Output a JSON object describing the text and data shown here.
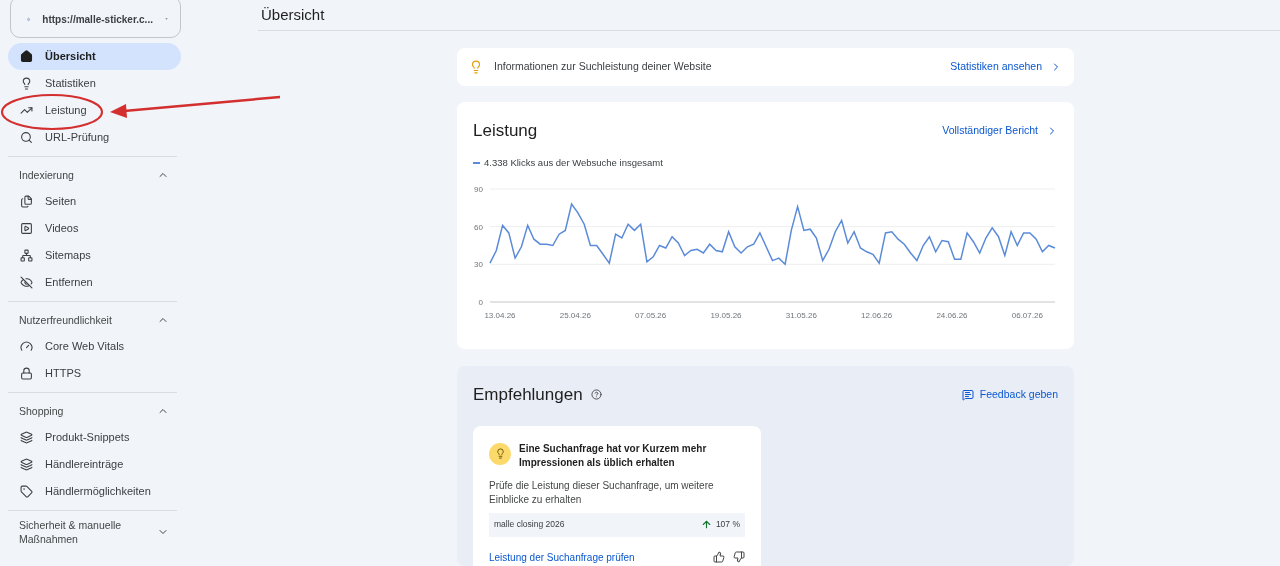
{
  "site_selector": {
    "value": "https://malle-sticker.c..."
  },
  "sidebar": [
    {
      "kind": "group",
      "items": [
        {
          "label": "Übersicht",
          "selected": true
        },
        {
          "label": "Statistiken",
          "selected": false
        },
        {
          "label": "Leistung",
          "selected": false
        },
        {
          "label": "URL-Prüfung",
          "selected": false
        }
      ]
    },
    {
      "kind": "section",
      "title": "Indexierung",
      "expanded": true,
      "items": [
        {
          "label": "Seiten",
          "selected": false
        },
        {
          "label": "Videos",
          "selected": false
        },
        {
          "label": "Sitemaps",
          "selected": false
        },
        {
          "label": "Entfernen",
          "selected": false
        }
      ]
    },
    {
      "kind": "section",
      "title": "Nutzerfreundlichkeit",
      "expanded": true,
      "items": [
        {
          "label": "Core Web Vitals",
          "selected": false
        },
        {
          "label": "HTTPS",
          "selected": false
        }
      ]
    },
    {
      "kind": "section",
      "title": "Shopping",
      "expanded": true,
      "items": [
        {
          "label": "Produkt-Snippets",
          "selected": false
        },
        {
          "label": "Händlereinträge",
          "selected": false
        },
        {
          "label": "Händlermöglichkeiten",
          "selected": false
        }
      ]
    },
    {
      "kind": "section",
      "title": "Sicherheit & manuelle Maßnahmen",
      "expanded": false
    }
  ],
  "page_title": "Übersicht",
  "info_card": {
    "text": "Informationen zur Suchleistung deiner Website",
    "link": "Statistiken ansehen"
  },
  "performance": {
    "title": "Leistung",
    "link": "Vollständiger Bericht",
    "legend": "4.338 Klicks aus der Websuche insgesamt",
    "x_axis_labels": [
      "13.04.26",
      "25.04.26",
      "07.05.26",
      "19.05.26",
      "31.05.26",
      "12.06.26",
      "24.06.26",
      "06.07.26"
    ],
    "chart_data": {
      "type": "line",
      "series": [
        {
          "color": "#5b8bd8",
          "values": [
            31,
            41,
            61,
            55,
            35,
            44,
            61,
            50,
            46,
            46,
            45,
            54,
            57,
            78,
            71,
            62,
            45,
            45,
            38,
            31,
            54,
            51,
            62,
            57,
            62,
            32,
            36,
            45,
            43,
            52,
            47,
            37,
            41,
            42,
            39,
            46,
            41,
            40,
            56,
            44,
            39,
            44,
            46,
            55,
            44,
            33,
            35,
            30,
            57,
            76,
            57,
            58,
            51,
            33,
            42,
            56,
            65,
            47,
            56,
            43,
            40,
            38,
            31,
            55,
            56,
            50,
            46,
            39,
            33,
            45,
            52,
            40,
            49,
            48,
            34,
            34,
            55,
            48,
            39,
            51,
            59,
            52,
            37,
            56,
            45,
            55,
            55,
            50,
            40,
            45,
            43
          ]
        }
      ],
      "ylim": [
        0,
        90
      ],
      "yticks": [
        0,
        30,
        60,
        90
      ]
    }
  },
  "recommendations": {
    "title": "Empfehlungen",
    "feedback": "Feedback geben",
    "card": {
      "title": "Eine Suchanfrage hat vor Kurzem mehr Impressionen als üblich erhalten",
      "body": "Prüfe die Leistung dieser Suchanfrage, um weitere Einblicke zu erhalten",
      "query": "malle closing 2026",
      "change": "107 %",
      "link": "Leistung der Suchanfrage prüfen"
    }
  }
}
